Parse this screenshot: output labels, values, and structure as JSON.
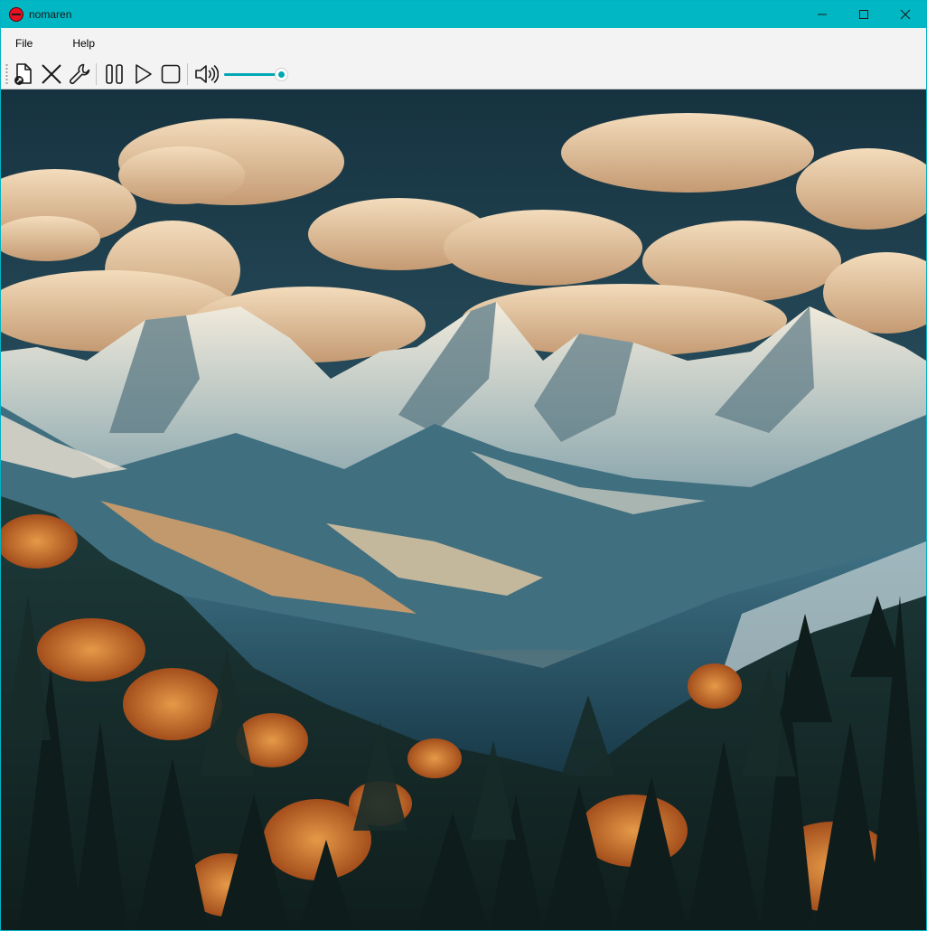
{
  "window": {
    "title": "nomaren",
    "app_icon": "no-entry-icon",
    "controls": [
      "minimize-icon",
      "maximize-icon",
      "close-icon"
    ],
    "accent": "#00b7c3"
  },
  "menu": {
    "file_label": "File",
    "help_label": "Help"
  },
  "toolbar": {
    "buttons": [
      "open-file-icon",
      "close-x-icon",
      "wrench-settings-icon",
      "pause-icon",
      "play-icon",
      "stop-icon",
      "speaker-volume-icon"
    ],
    "volume_level": 0.92,
    "slider_color": "#00a7b5"
  },
  "content": {
    "image": "mountain-landscape-image"
  }
}
